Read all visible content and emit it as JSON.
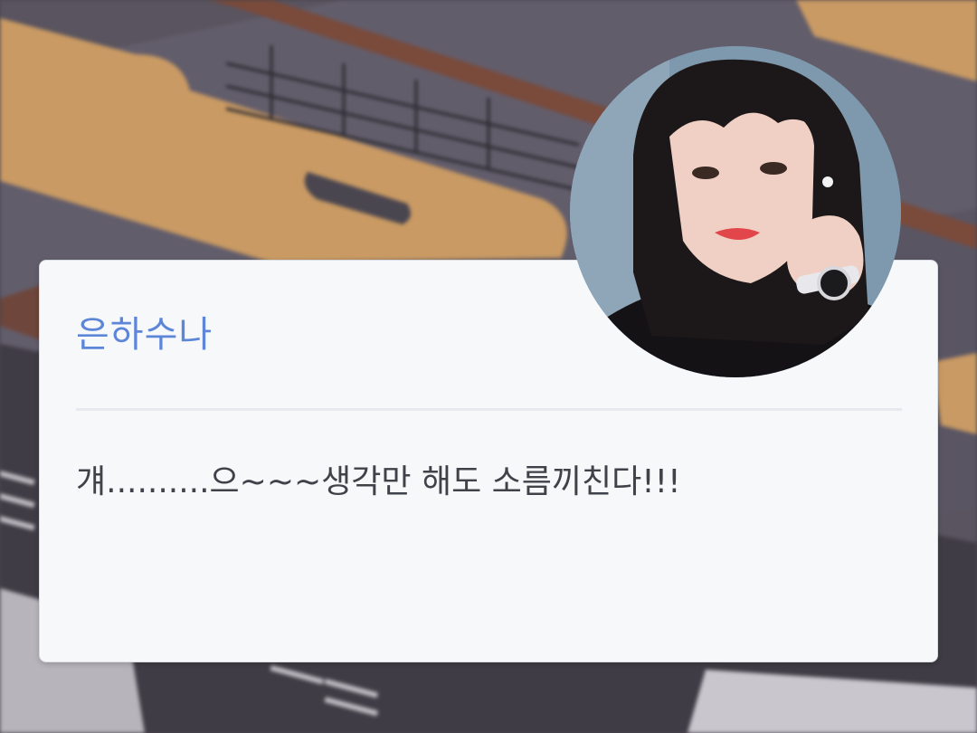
{
  "dialogue": {
    "speaker_name": "은하수나",
    "message": "걔..........으~~~생각만 해도 소름끼친다!!!"
  },
  "avatar": {
    "icon": "portrait-photo"
  },
  "background": {
    "icon": "classroom-desks-photo"
  },
  "colors": {
    "speaker_name": "#5d86d9",
    "message_text": "#3f4248",
    "card_background": "#f6f8fa",
    "divider": "#e6e9ee"
  }
}
